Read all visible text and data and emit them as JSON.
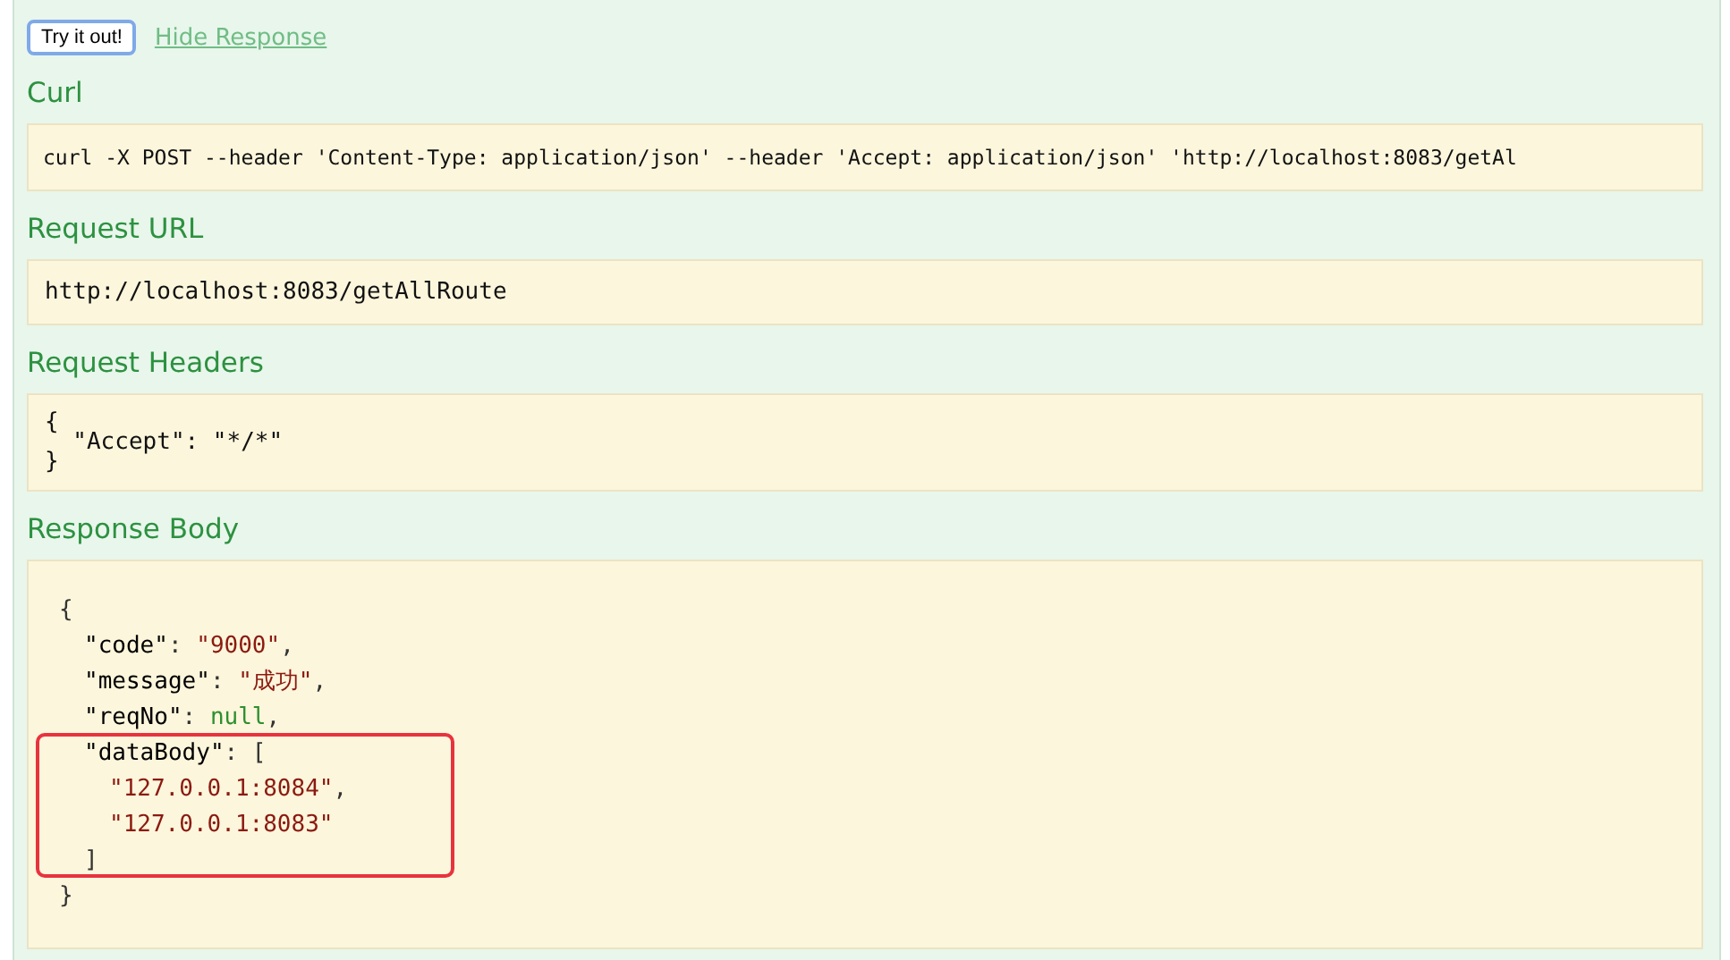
{
  "actions": {
    "try_button": "Try it out!",
    "hide_link": "Hide Response"
  },
  "curl": {
    "heading": "Curl",
    "command": "curl -X POST --header 'Content-Type: application/json' --header 'Accept: application/json' 'http://localhost:8083/getAl"
  },
  "request_url": {
    "heading": "Request URL",
    "url": "http://localhost:8083/getAllRoute"
  },
  "request_headers": {
    "heading": "Request Headers",
    "lines": [
      "{",
      "  \"Accept\": \"*/*\"",
      "}"
    ]
  },
  "response_body": {
    "heading": "Response Body",
    "root": {
      "highlighted": false,
      "open": [
        {
          "kind": "punct",
          "text": "{"
        }
      ],
      "close": [
        {
          "kind": "punct",
          "text": "}"
        }
      ],
      "children": [
        {
          "highlighted": false,
          "open": [
            {
              "kind": "key",
              "text": "\"code\""
            },
            {
              "kind": "punct",
              "text": ": "
            },
            {
              "kind": "string",
              "text": "\"9000\""
            },
            {
              "kind": "punct",
              "text": ","
            }
          ]
        },
        {
          "highlighted": false,
          "open": [
            {
              "kind": "key",
              "text": "\"message\""
            },
            {
              "kind": "punct",
              "text": ": "
            },
            {
              "kind": "string",
              "text": "\"成功\""
            },
            {
              "kind": "punct",
              "text": ","
            }
          ]
        },
        {
          "highlighted": false,
          "open": [
            {
              "kind": "key",
              "text": "\"reqNo\""
            },
            {
              "kind": "punct",
              "text": ": "
            },
            {
              "kind": "null",
              "text": "null"
            },
            {
              "kind": "punct",
              "text": ","
            }
          ]
        },
        {
          "highlighted": true,
          "open": [
            {
              "kind": "key",
              "text": "\"dataBody\""
            },
            {
              "kind": "punct",
              "text": ": ["
            }
          ],
          "close": [
            {
              "kind": "punct",
              "text": "]"
            }
          ],
          "children": [
            {
              "highlighted": false,
              "open": [
                {
                  "kind": "string",
                  "text": "\"127.0.0.1:8084\""
                },
                {
                  "kind": "punct",
                  "text": ","
                }
              ]
            },
            {
              "highlighted": false,
              "open": [
                {
                  "kind": "string",
                  "text": "\"127.0.0.1:8083\""
                }
              ]
            }
          ]
        }
      ]
    }
  }
}
